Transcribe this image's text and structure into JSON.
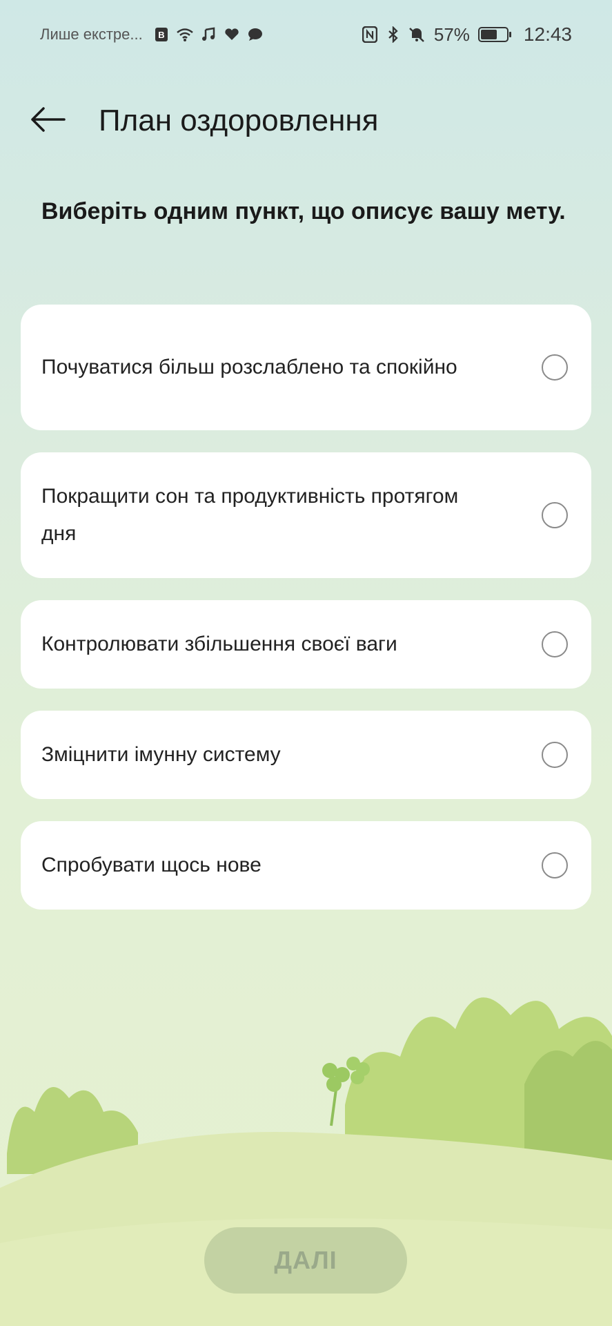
{
  "status_bar": {
    "notification_text": "Лише екстре...",
    "left_icons": [
      "b-app-icon",
      "wifi-icon",
      "music-icon",
      "heart-icon",
      "chat-icon"
    ],
    "right_icons": [
      "nfc-icon",
      "bluetooth-icon",
      "mute-bell-icon"
    ],
    "battery_percent": "57%",
    "battery_level": 0.57,
    "time": "12:43"
  },
  "header": {
    "back_icon": "arrow-left-icon",
    "title": "План оздоровлення"
  },
  "subtitle": "Виберіть одним пункт, що описує вашу мету.",
  "options": [
    {
      "label": "Почуватися більш розслаблено та спокійно",
      "selected": false
    },
    {
      "label": "Покращити сон та продуктивність протягом дня",
      "selected": false
    },
    {
      "label": "Контролювати збільшення своєї ваги",
      "selected": false
    },
    {
      "label": "Зміцнити імунну систему",
      "selected": false
    },
    {
      "label": "Спробувати щось нове",
      "selected": false
    }
  ],
  "next_button": {
    "label": "ДАЛІ",
    "enabled": false
  },
  "colors": {
    "background_top": "#cfe8e6",
    "background_bottom": "#e6f1cf",
    "card": "#ffffff",
    "button_disabled": "#c3d2a3",
    "button_text_disabled": "#9aa98a",
    "hill": "#dde9b4",
    "bush": "#b9d57e"
  }
}
